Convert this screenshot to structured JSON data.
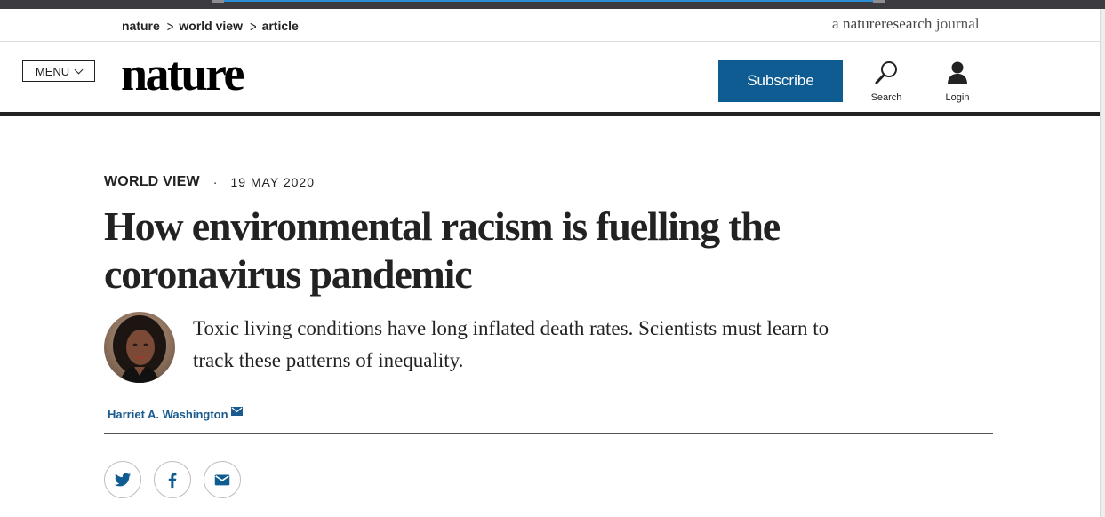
{
  "breadcrumb": {
    "items": [
      "nature",
      "world view",
      "article"
    ]
  },
  "network": {
    "prefix": "a",
    "brand": "natureresearch",
    "suffix": "journal"
  },
  "header": {
    "menu_label": "MENU",
    "logo": "nature",
    "subscribe_label": "Subscribe",
    "search_label": "Search",
    "login_label": "Login"
  },
  "article": {
    "section": "WORLD VIEW",
    "separator": "·",
    "date": "19 MAY 2020",
    "title": "How environmental racism is fuelling the coronavirus pandemic",
    "standfirst": "Toxic living conditions have long inflated death rates. Scientists must learn to track these patterns of inequality.",
    "author": "Harriet A. Washington"
  },
  "share": [
    "twitter-icon",
    "facebook-icon",
    "email-icon"
  ],
  "colors": {
    "accent": "#0e5c91",
    "author_link": "#1a5b8f",
    "text": "#222222"
  }
}
